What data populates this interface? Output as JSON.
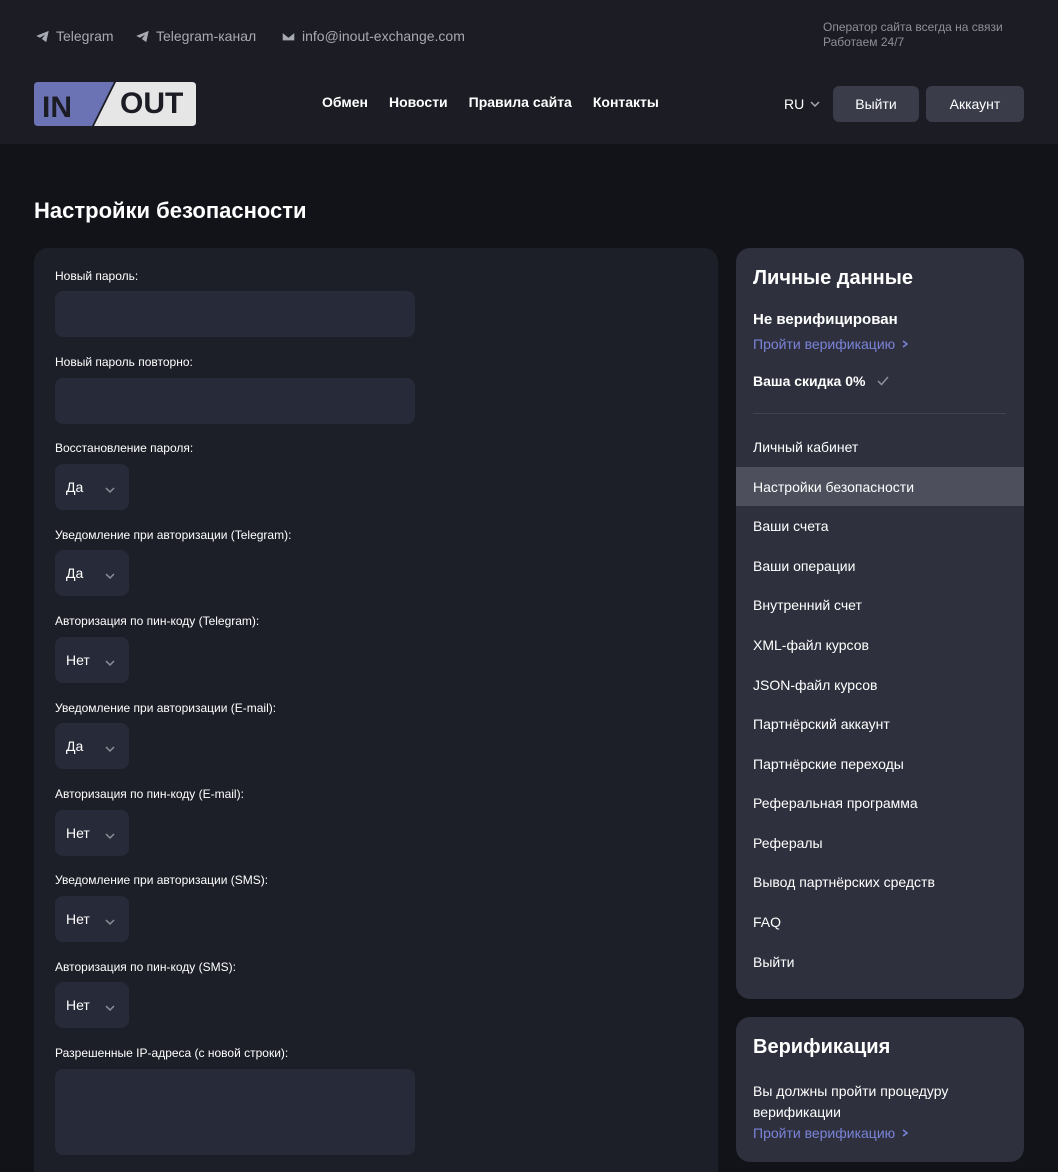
{
  "topbar": {
    "telegram": "Telegram",
    "telegram_channel": "Telegram-канал",
    "email": "info@inout-exchange.com",
    "operator_line1": "Оператор сайта всегда на связи",
    "operator_line2": "Работаем 24/7"
  },
  "logo": {
    "left": "IN",
    "right": "OUT"
  },
  "nav": [
    "Обмен",
    "Новости",
    "Правила сайта",
    "Контакты"
  ],
  "lang": "RU",
  "buttons": {
    "logout": "Выйти",
    "account": "Аккаунт"
  },
  "page_title": "Настройки безопасности",
  "form": {
    "new_password_label": "Новый пароль:",
    "new_password_repeat_label": "Новый пароль повторно:",
    "fields": [
      {
        "label": "Восстановление пароля:",
        "value": "Да"
      },
      {
        "label": "Уведомление при авторизации (Telegram):",
        "value": "Да"
      },
      {
        "label": "Авторизация по пин-коду (Telegram):",
        "value": "Нет"
      },
      {
        "label": "Уведомление при авторизации (E-mail):",
        "value": "Да"
      },
      {
        "label": "Авторизация по пин-коду (E-mail):",
        "value": "Нет"
      },
      {
        "label": "Уведомление при авторизации (SMS):",
        "value": "Нет"
      },
      {
        "label": "Авторизация по пин-коду (SMS):",
        "value": "Нет"
      }
    ],
    "allowed_ip_label": "Разрешенные IP-адреса (с новой строки):"
  },
  "sidebar": {
    "title": "Личные данные",
    "status": "Не верифицирован",
    "verify_link": "Пройти верификацию",
    "discount": "Ваша скидка 0%",
    "items": [
      "Личный кабинет",
      "Настройки безопасности",
      "Ваши счета",
      "Ваши операции",
      "Внутренний счет",
      "XML-файл курсов",
      "JSON-файл курсов",
      "Партнёрский аккаунт",
      "Партнёрские переходы",
      "Реферальная программа",
      "Рефералы",
      "Вывод партнёрских средств",
      "FAQ",
      "Выйти"
    ],
    "active_item": "Настройки безопасности"
  },
  "verification": {
    "title": "Верификация",
    "text": "Вы должны пройти процедуру верификации",
    "link": "Пройти верификацию"
  },
  "colors": {
    "background": "#121318",
    "header": "#1c1d24",
    "card": "#1d1f28",
    "sidebar": "#2e313d",
    "accent_link": "#7b83d9",
    "logo_in": "#6b73b5",
    "logo_out": "#e6e6e6"
  }
}
